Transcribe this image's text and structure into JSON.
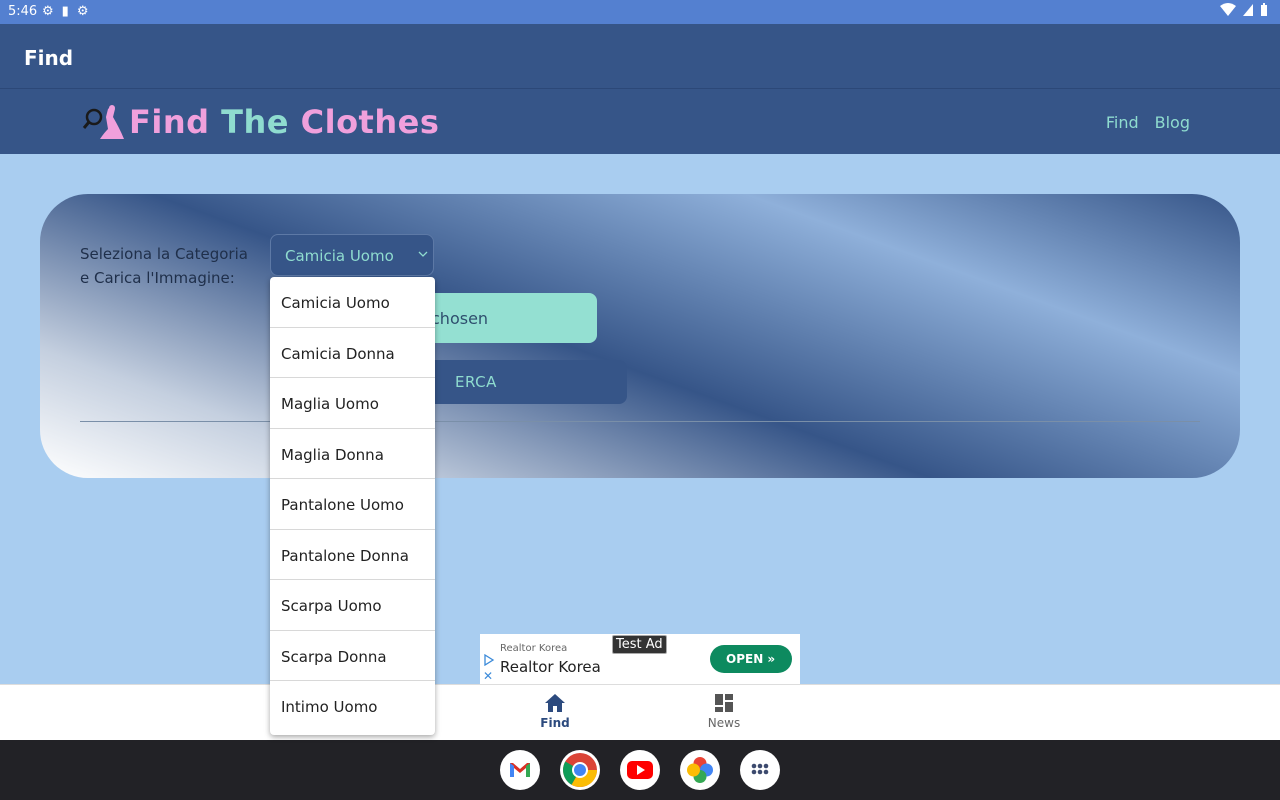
{
  "status_bar": {
    "time": "5:46"
  },
  "app_bar": {
    "title": "Find"
  },
  "site_header": {
    "logo_words": [
      "Find",
      "The",
      "Clothes"
    ],
    "nav": [
      "Find",
      "Blog"
    ]
  },
  "form": {
    "label_line1": "Seleziona la Categoria",
    "label_line2": "e Carica l'Immagine:",
    "selected_category": "Camicia Uomo",
    "file_button_text": "chosen",
    "search_button_text": "ERCA"
  },
  "dropdown": {
    "options": [
      "Camicia Uomo",
      "Camicia Donna",
      "Maglia Uomo",
      "Maglia Donna",
      "Pantalone Uomo",
      "Pantalone Donna",
      "Scarpa Uomo",
      "Scarpa Donna",
      "Intimo Uomo"
    ]
  },
  "ad": {
    "advertiser": "Realtor Korea",
    "headline": "Realtor Korea",
    "badge": "Test Ad",
    "cta": "OPEN"
  },
  "bottom_nav": {
    "items": [
      {
        "label": "Find",
        "icon": "home-icon",
        "active": true
      },
      {
        "label": "News",
        "icon": "dashboard-icon",
        "active": false
      }
    ]
  },
  "taskbar": {
    "apps": [
      "gmail-icon",
      "chrome-icon",
      "youtube-icon",
      "photos-icon",
      "app-drawer-icon"
    ]
  },
  "colors": {
    "header": "#365588",
    "accent_teal": "#8fdccf",
    "accent_pink": "#f0a0dc",
    "background": "#a9cdf0"
  }
}
